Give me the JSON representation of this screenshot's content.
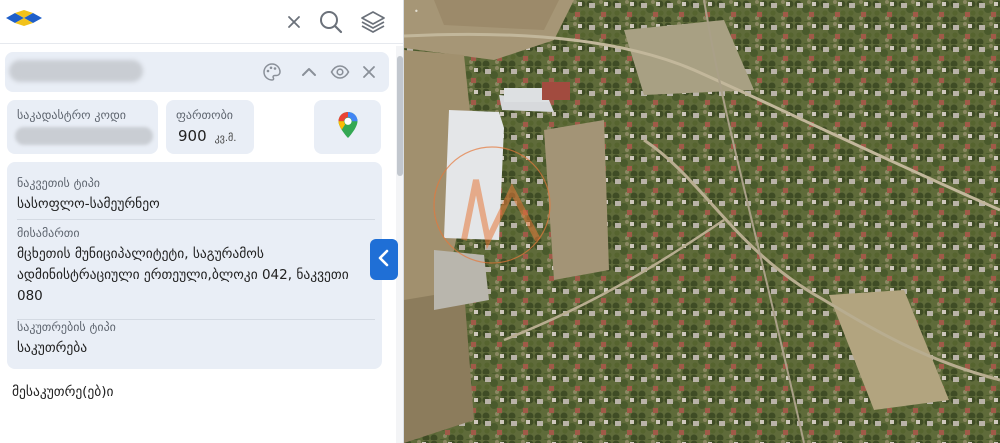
{
  "colors": {
    "accent": "#1f6fd6",
    "card_bg": "#e9eef6"
  },
  "icons": {
    "logo": "logo-icon",
    "clear": "close-icon",
    "search": "search-icon",
    "layers": "layers-icon",
    "palette": "palette-icon",
    "collapse": "chevron-up-icon",
    "visibility": "eye-icon",
    "close": "close-icon",
    "map_pin": "google-maps-pin-icon",
    "toggle": "chevron-left-icon"
  },
  "parcel": {
    "cadastral_code_label": "საკადასტრო კოდი",
    "area_label": "ფართობი",
    "area_value": "900",
    "area_unit": "კვ.მ.",
    "land_type_label": "ნაკვეთის ტიპი",
    "land_type_value": "სასოფლო-სამეურნეო",
    "address_label": "მისამართი",
    "address_value": "მცხეთის მუნიციპალიტეტი, საგურამოს ადმინისტრაციული ერთეული,ბლოკი 042, ნაკვეთი 080",
    "ownership_type_label": "საკუთრების ტიპი",
    "ownership_type_value": "საკუთრება"
  },
  "owners_title": "მესაკუთრე(ებ)ი"
}
